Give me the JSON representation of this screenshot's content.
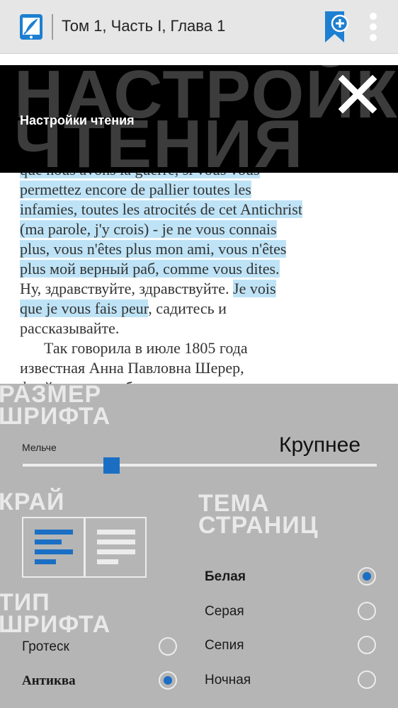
{
  "appbar": {
    "title": "Том 1, Часть I, Глава 1",
    "logo_icon": "quill-phone-icon",
    "bookmark_icon": "bookmark-add-icon",
    "menu_icon": "overflow-menu-icon"
  },
  "settings_header": {
    "bg_word_1": "НАСТРОЙКИ",
    "bg_word_2": "ЧТЕНИЯ",
    "title": "Настройки чтения",
    "close_icon": "close-icon"
  },
  "book": {
    "lines": [
      "que nous avons la guerre, si vous vous",
      "permettez encore de pallier toutes les",
      "infamies, toutes les atrocités de cet Antichrist",
      "(ma parole, j'y crois) - je ne vous connais",
      "plus, vous n'êtes plus mon ami, vous n'êtes",
      "plus мой верный раб, comme vous dites."
    ],
    "line7_plain": "Ну, здравствуйте, здравствуйте. ",
    "line7_hl": "Je vois",
    "line8_hl": "que je vous fais peur",
    "line8_plain": ", садитесь и",
    "line9": "рассказывайте.",
    "line10": "Так говорила в июле 1805 года",
    "line11": "известная Анна Павловна Шерер,",
    "line12": "фрейлина и приближенная императрицы"
  },
  "font_size": {
    "heading_1": "РАЗМЕР",
    "heading_2": "ШРИФТА",
    "smaller_label": "Мельче",
    "larger_label": "Крупнее",
    "level": 0.25
  },
  "edge": {
    "heading": "КРАЙ",
    "options": [
      "align-left-icon",
      "justify-icon"
    ],
    "selected": "align-left-icon"
  },
  "theme": {
    "heading_1": "ТЕМА",
    "heading_2": "СТРАНИЦ",
    "options": [
      "Белая",
      "Серая",
      "Сепия",
      "Ночная"
    ],
    "selected": "Белая"
  },
  "font_type": {
    "heading_1": "ТИП",
    "heading_2": "ШРИФТА",
    "options": [
      "Гротеск",
      "Антиква"
    ],
    "selected": "Антиква"
  },
  "colors": {
    "accent": "#1a6fc4",
    "highlight": "#bfe3f6",
    "panel": "#b5b5b5",
    "appbar": "#e6e6e6"
  }
}
